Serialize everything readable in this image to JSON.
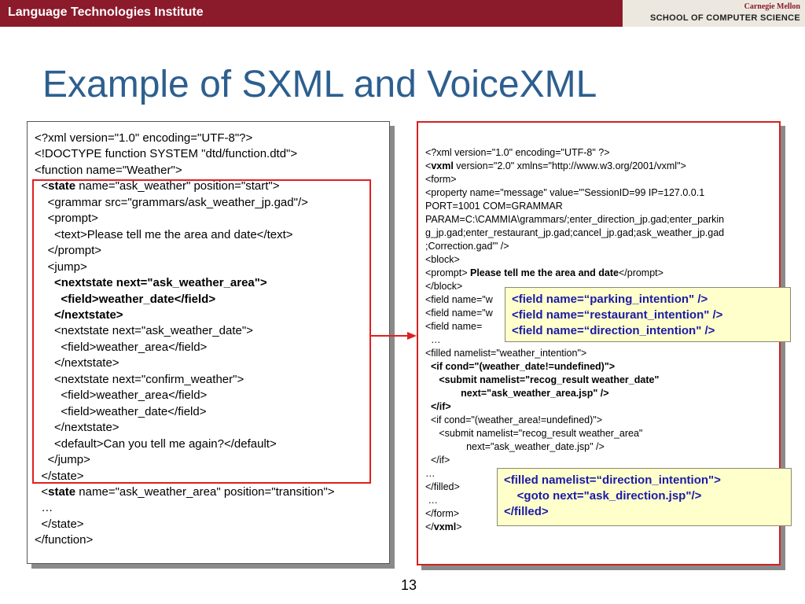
{
  "header": {
    "institute": "Language Technologies Institute",
    "cmu_name": "Carnegie Mellon",
    "school": "SCHOOL OF COMPUTER SCIENCE"
  },
  "slide": {
    "title": "Example of SXML and VoiceXML",
    "page_number": "13"
  },
  "sxml_lines": [
    {
      "t": "<?xml version=\"1.0\" encoding=\"UTF-8\"?>"
    },
    {
      "t": "<!DOCTYPE function SYSTEM \"dtd/function.dtd\">"
    },
    {
      "t": "<function name=\"Weather\">"
    },
    {
      "pre": "  <",
      "b": "state",
      "t": " name=\"ask_weather\" position=\"start\">"
    },
    {
      "t": "    <grammar src=\"grammars/ask_weather_jp.gad\"/>"
    },
    {
      "t": "    <prompt>"
    },
    {
      "t": "      <text>Please tell me the area and date</text>"
    },
    {
      "t": "    </prompt>"
    },
    {
      "t": "    <jump>"
    },
    {
      "b": "      <nextstate next=\"ask_weather_area\">"
    },
    {
      "b": "        <field>weather_date</field>"
    },
    {
      "b": "      </nextstate>"
    },
    {
      "t": "      <nextstate next=\"ask_weather_date\">"
    },
    {
      "t": "        <field>weather_area</field>"
    },
    {
      "t": "      </nextstate>"
    },
    {
      "t": "      <nextstate next=\"confirm_weather\">"
    },
    {
      "t": "        <field>weather_area</field>"
    },
    {
      "t": "        <field>weather_date</field>"
    },
    {
      "t": "      </nextstate>"
    },
    {
      "t": "      <default>Can you tell me again?</default>"
    },
    {
      "t": "    </jump>"
    },
    {
      "t": "  </state>"
    },
    {
      "pre": "  <",
      "b": "state",
      "t": " name=\"ask_weather_area\" position=\"transition\">"
    },
    {
      "t": "  …"
    },
    {
      "t": "  </state>"
    },
    {
      "t": "</function>"
    }
  ],
  "vxml_lines": [
    {
      "t": "<?xml version=\"1.0\" encoding=\"UTF-8\" ?>"
    },
    {
      "pre": "<",
      "b": "vxml",
      "t": " version=\"2.0\" xmlns=\"http://www.w3.org/2001/vxml\">"
    },
    {
      "t": "<form>"
    },
    {
      "t": "<property name=\"message\" value=\"'SessionID=99 IP=127.0.0.1"
    },
    {
      "t": "PORT=1001 COM=GRAMMAR"
    },
    {
      "t": "PARAM=C:\\CAMMIA\\grammars/;enter_direction_jp.gad;enter_parkin"
    },
    {
      "t": "g_jp.gad;enter_restaurant_jp.gad;cancel_jp.gad;ask_weather_jp.gad"
    },
    {
      "t": ";Correction.gad'\" />"
    },
    {
      "t": "<block>"
    },
    {
      "pre": "<prompt> ",
      "b": "Please tell me the area and date",
      "t": "</prompt>"
    },
    {
      "t": "</block>"
    },
    {
      "t": "<field name=\"w"
    },
    {
      "t": "<field name=\"w"
    },
    {
      "t": "<field name="
    },
    {
      "t": "  …"
    },
    {
      "t": "<filled namelist=\"weather_intention\">"
    },
    {
      "b": "  <if cond=\"(weather_date!=undefined)\">"
    },
    {
      "b": "     <submit namelist=\"recog_result weather_date\""
    },
    {
      "b": "             next=\"ask_weather_area.jsp\" />"
    },
    {
      "b": "  </if>"
    },
    {
      "t": "  <if cond=\"(weather_area!=undefined)\">"
    },
    {
      "t": "     <submit namelist=\"recog_result weather_area\""
    },
    {
      "t": "               next=\"ask_weather_date.jsp\" />"
    },
    {
      "t": "  </if>"
    },
    {
      "t": "…"
    },
    {
      "t": "</filled>"
    },
    {
      "t": " …"
    },
    {
      "t": "</form>"
    },
    {
      "pre": "</",
      "b": "vxml",
      "t": ">"
    }
  ],
  "callouts": {
    "fields": "<field name=“parking_intention\" />\n<field name=“restaurant_intention\" />\n<field name=“direction_intention\" />",
    "filled": "<filled namelist=“direction_intention\">\n    <goto next=\"ask_direction.jsp\"/>\n</filled>"
  },
  "colors": {
    "header_bar": "#8b1a2b",
    "title": "#2d5f8f",
    "highlight_border": "#e02020",
    "callout_bg": "#ffffcc",
    "callout_text": "#1a1aa6"
  }
}
